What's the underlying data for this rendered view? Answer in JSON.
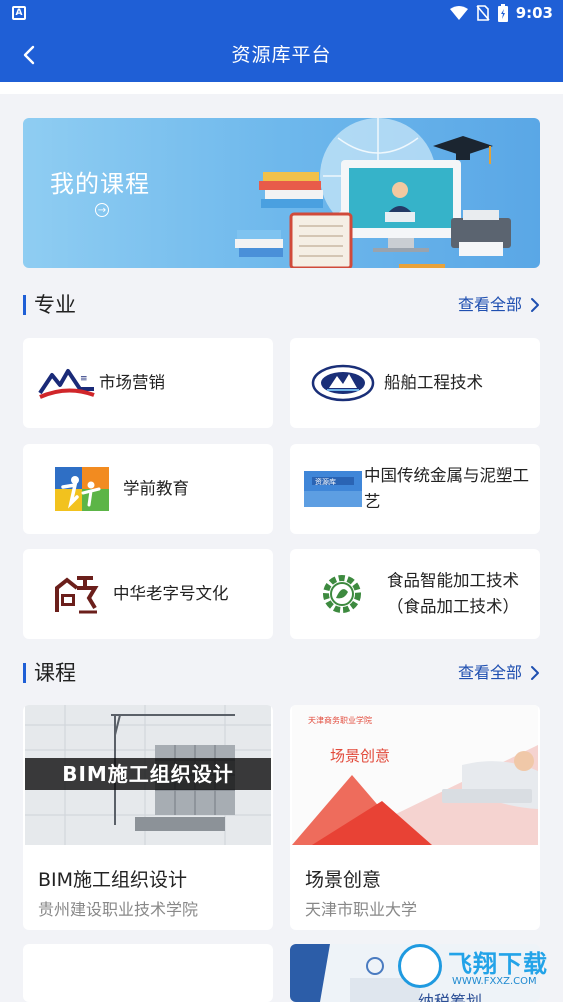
{
  "status": {
    "left_icon": "A",
    "time": "9:03"
  },
  "header": {
    "title": "资源库平台"
  },
  "banner": {
    "title": "我的课程"
  },
  "majors_section": {
    "title": "专业",
    "more": "查看全部"
  },
  "majors": [
    {
      "name": "市场营销",
      "icon": "mountain-logo-icon"
    },
    {
      "name": "船舶工程技术",
      "icon": "ship-seal-icon"
    },
    {
      "name": "学前教育",
      "icon": "children-logo-icon"
    },
    {
      "name": "中国传统金属与泥塑工艺",
      "icon": "resource-library-logo-icon"
    },
    {
      "name": "中华老字号文化",
      "icon": "old-brand-logo-icon"
    },
    {
      "name": "食品智能加工技术（食品加工技术）",
      "icon": "gear-leaf-logo-icon"
    }
  ],
  "courses_section": {
    "title": "课程",
    "more": "查看全部"
  },
  "courses": [
    {
      "name": "BIM施工组织设计",
      "school": "贵州建设职业技术学院",
      "thumb_text": "BIM施工组织设计"
    },
    {
      "name": "场景创意",
      "school": "天津市职业大学",
      "thumb_text": "场景创意",
      "thumb_small": "天津商务职业学院"
    }
  ],
  "partial_card": {
    "thumb_text": "纳税筹划"
  },
  "watermark": {
    "text": "飞翔下载",
    "url": "WWW.FXXZ.COM"
  },
  "colors": {
    "primary": "#1f5fd6",
    "link": "#1f4fb0",
    "background": "#f2f3f7"
  }
}
